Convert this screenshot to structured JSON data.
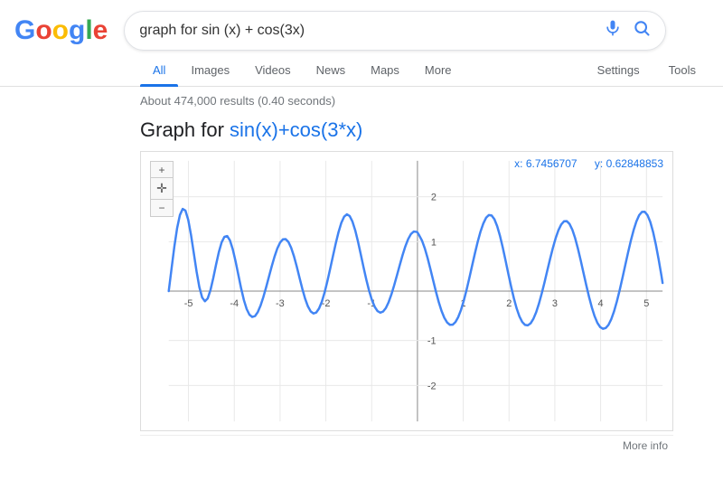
{
  "header": {
    "logo_letters": [
      "G",
      "o",
      "o",
      "g",
      "l",
      "e"
    ],
    "search_value": "graph for sin (x) + cos(3x)",
    "mic_label": "🎤",
    "search_label": "🔍"
  },
  "nav": {
    "tabs": [
      {
        "id": "all",
        "label": "All",
        "active": true
      },
      {
        "id": "images",
        "label": "Images",
        "active": false
      },
      {
        "id": "videos",
        "label": "Videos",
        "active": false
      },
      {
        "id": "news",
        "label": "News",
        "active": false
      },
      {
        "id": "maps",
        "label": "Maps",
        "active": false
      },
      {
        "id": "more",
        "label": "More",
        "active": false
      }
    ],
    "right_tabs": [
      {
        "id": "settings",
        "label": "Settings"
      },
      {
        "id": "tools",
        "label": "Tools"
      }
    ]
  },
  "results": {
    "stats": "About 474,000 results (0.40 seconds)",
    "title_prefix": "Graph for ",
    "title_formula": "sin(x)+cos(3*x)",
    "coords": {
      "x_label": "x: 6.7456707",
      "y_label": "y: 0.62848853"
    },
    "more_info": "More info"
  }
}
